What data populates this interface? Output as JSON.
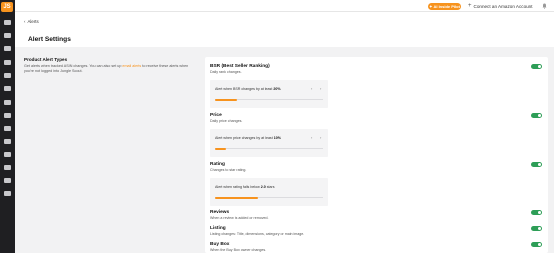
{
  "sidebar": {
    "logo": "JS"
  },
  "topbar": {
    "ai_pill": "AI Inside Pilot",
    "connect_label": "Connect an Amazon Account",
    "avatar_initials": "SC"
  },
  "header": {
    "back_label": "Alerts",
    "title": "Alert Settings"
  },
  "product_alert_types": {
    "title": "Product Alert Types",
    "desc_before": "Get alerts when tracked ASIN changes. You can also set up ",
    "desc_link": "email alerts",
    "desc_after": " to receive these alerts when you're not logged into Jungle Scout."
  },
  "alerts": {
    "bsr": {
      "title": "BSR (Best Seller Ranking)",
      "sub": "Daily rank changes.",
      "setting_prefix": "Alert when BSR changes by at least",
      "setting_value": "20%",
      "fill_fraction": 0.2
    },
    "price": {
      "title": "Price",
      "sub": "Daily price changes.",
      "setting_prefix": "Alert when price changes by at least",
      "setting_value": "10%",
      "fill_fraction": 0.1
    },
    "rating": {
      "title": "Rating",
      "sub": "Changes to star rating.",
      "setting_prefix": "Alert when rating falls below",
      "setting_value": "2.0",
      "setting_suffix": "stars",
      "fill_fraction": 0.4
    },
    "reviews": {
      "title": "Reviews",
      "sub": "When a review is added or removed."
    },
    "listing": {
      "title": "Listing",
      "sub": "Listing changes: Title, dimensions, category or main image."
    },
    "buybox": {
      "title": "Buy Box",
      "sub": "When the Buy Box owner changes."
    }
  },
  "colors": {
    "accent": "#f7931e",
    "toggle_on": "#2e9e57",
    "sidebar_bg": "#1f1f22"
  }
}
